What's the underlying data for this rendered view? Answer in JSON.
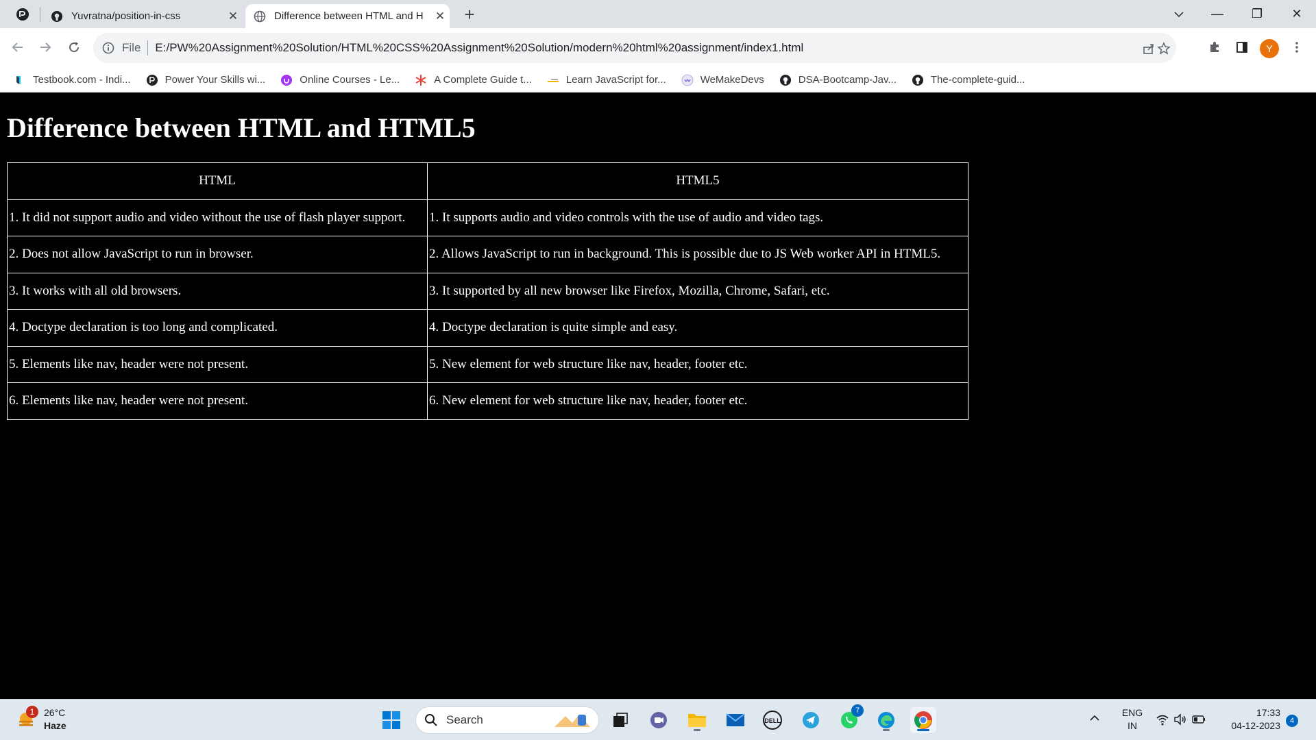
{
  "browser": {
    "tabs": [
      {
        "title": "Yuvratna/position-in-css",
        "close": "✕"
      },
      {
        "title": "Difference between HTML and H",
        "close": "✕"
      }
    ],
    "new_tab": "+",
    "window_controls": {
      "minimize": "—",
      "restore": "❐",
      "close": "✕"
    },
    "address": {
      "scheme": "File",
      "url": "E:/PW%20Assignment%20Solution/HTML%20CSS%20Assignment%20Solution/modern%20html%20assignment/index1.html"
    },
    "profile_initial": "Y",
    "bookmarks": [
      {
        "label": "Testbook.com - Indi...",
        "icon": "testbook-icon"
      },
      {
        "label": "Power Your Skills wi...",
        "icon": "pw-icon"
      },
      {
        "label": "Online Courses - Le...",
        "icon": "udemy-icon"
      },
      {
        "label": "A Complete Guide t...",
        "icon": "asterisk-icon"
      },
      {
        "label": "Learn JavaScript for...",
        "icon": "js-icon"
      },
      {
        "label": "WeMakeDevs",
        "icon": "wemakedevs-icon"
      },
      {
        "label": "DSA-Bootcamp-Jav...",
        "icon": "github-icon"
      },
      {
        "label": "The-complete-guid...",
        "icon": "github-icon"
      }
    ]
  },
  "page": {
    "heading": "Difference between HTML and HTML5",
    "table": {
      "headers": [
        "HTML",
        "HTML5"
      ],
      "rows": [
        [
          "1. It did not support audio and video without the use of flash player support.",
          "1. It supports audio and video controls with the use of audio and video tags."
        ],
        [
          "2. Does not allow JavaScript to run in browser.",
          "2. Allows JavaScript to run in background. This is possible due to JS Web worker API in HTML5."
        ],
        [
          "3. It works with all old browsers.",
          "3. It supported by all new browser like Firefox, Mozilla, Chrome, Safari, etc."
        ],
        [
          "4. Doctype declaration is too long and complicated.",
          "4. Doctype declaration is quite simple and easy."
        ],
        [
          "5. Elements like nav, header were not present.",
          "5. New element for web structure like nav, header, footer etc."
        ],
        [
          "6. Elements like nav, header were not present.",
          "6. New element for web structure like nav, header, footer etc."
        ]
      ]
    }
  },
  "taskbar": {
    "weather": {
      "temp": "26°C",
      "condition": "Haze",
      "badge": "1"
    },
    "search_label": "Search",
    "telegram_badge": "7",
    "tray": {
      "lang": "ENG",
      "region": "IN",
      "time": "17:33",
      "date": "04-12-2023",
      "notifications": "4"
    }
  }
}
